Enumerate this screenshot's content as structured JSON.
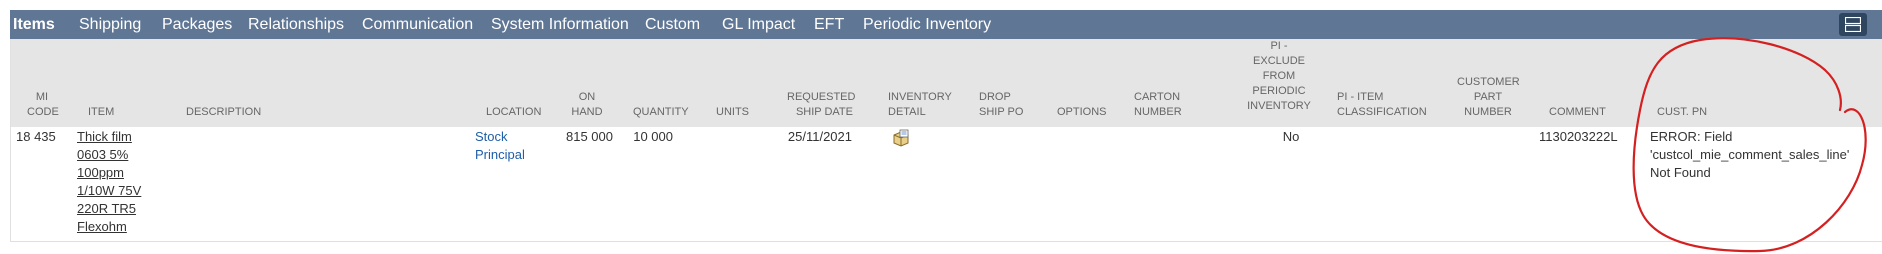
{
  "tabs": [
    {
      "label": "Items",
      "active": true
    },
    {
      "label": "Shipping"
    },
    {
      "label": "Packages"
    },
    {
      "label": "Relationships"
    },
    {
      "label": "Communication"
    },
    {
      "label": "System Information"
    },
    {
      "label": "Custom"
    },
    {
      "label": "GL Impact"
    },
    {
      "label": "EFT"
    },
    {
      "label": "Periodic Inventory"
    }
  ],
  "columns": {
    "mi_code": "MI\nCODE",
    "item": "ITEM",
    "description": "DESCRIPTION",
    "location": "LOCATION",
    "on_hand": "ON\nHAND",
    "quantity": "QUANTITY",
    "units": "UNITS",
    "requested_ship_date": "REQUESTED\nSHIP DATE",
    "inventory_detail": "INVENTORY\nDETAIL",
    "drop_ship_po": "DROP\nSHIP PO",
    "options": "OPTIONS",
    "carton_number": "CARTON\nNUMBER",
    "pi_exclude": "PI -\nEXCLUDE\nFROM\nPERIODIC\nINVENTORY",
    "pi_classification": "PI - ITEM\nCLASSIFICATION",
    "customer_part_number": "CUSTOMER\nPART\nNUMBER",
    "comment": "COMMENT",
    "cust_pn": "CUST. PN"
  },
  "row": {
    "mi_code": "18 435",
    "item": "Thick film\n0603 5%\n100ppm\n1/10W 75V\n220R TR5\nFlexohm",
    "location": "Stock\nPrincipal",
    "on_hand": "815 000",
    "quantity": "10 000",
    "requested_ship_date": "25/11/2021",
    "pi_exclude": "No",
    "comment": "1130203222L",
    "cust_pn": "ERROR: Field\n'custcol_mie_comment_sales_line'\nNot Found"
  },
  "colors": {
    "tabbar": "#5f7694",
    "header": "#e5e5e5",
    "annotation": "#d42020",
    "link": "#1f5ea8"
  },
  "icons": {
    "menu": "list-view-icon",
    "inventory_detail": "inventory-detail-icon"
  }
}
